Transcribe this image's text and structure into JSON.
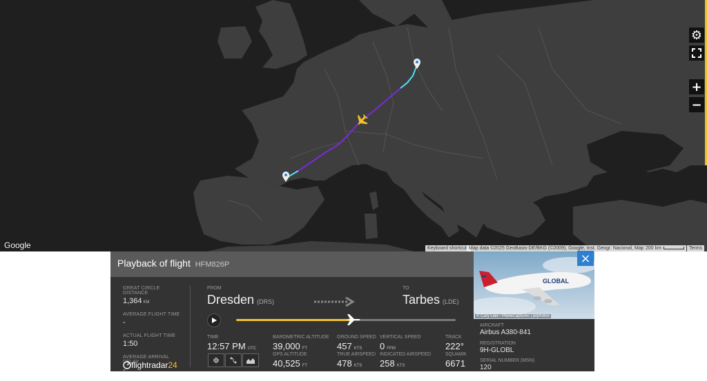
{
  "map": {
    "google_label": "Google",
    "attribution": {
      "shortcuts": "Keyboard shortcuts",
      "data": "Map data ©2025 GeoBasis-DE/BKG (©2009), Google, Inst. Geogr. Nacional, Mapa GISrael",
      "scale": "200 km",
      "terms": "Terms"
    },
    "controls": {
      "settings_icon": "gear-icon",
      "fullscreen_icon": "fullscreen-icon",
      "zoom_in": "+",
      "zoom_out": "−"
    },
    "colors": {
      "water": "#1f1f1f",
      "land": "#3e3e3e",
      "route_start": "#4fe0ff",
      "route_main": "#7a2bd6",
      "aircraft": "#f2c12e"
    }
  },
  "playback": {
    "title": "Playback of flight",
    "callsign": "HFM826P",
    "stats": [
      {
        "label": "GREAT CIRCLE DISTANCE",
        "value": "1,364",
        "unit": "KM"
      },
      {
        "label": "AVERAGE FLIGHT TIME",
        "value": "-",
        "unit": ""
      },
      {
        "label": "ACTUAL FLIGHT TIME",
        "value": "1:50",
        "unit": ""
      },
      {
        "label": "AVERAGE ARRIVAL DELAY",
        "value": "-",
        "unit": ""
      }
    ],
    "logo": {
      "text": "flightradar",
      "num": "24"
    },
    "from_label": "FROM",
    "from_city": "Dresden",
    "from_code": "(DRS)",
    "to_label": "TO",
    "to_city": "Tarbes",
    "to_code": "(LDE)",
    "progress": 0.53,
    "metrics": {
      "time": {
        "label": "TIME",
        "value": "12:57 PM",
        "unit": "UTC"
      },
      "baro_alt": {
        "label": "BAROMETRIC ALTITUDE",
        "value": "39,000",
        "unit": "FT"
      },
      "gps_alt": {
        "label": "GPS ALTITUDE",
        "value": "40,525",
        "unit": "FT"
      },
      "ground_speed": {
        "label": "GROUND SPEED",
        "value": "457",
        "unit": "KTS"
      },
      "true_airspeed": {
        "label": "TRUE AIRSPEED",
        "value": "478",
        "unit": "KTS"
      },
      "vertical_speed": {
        "label": "VERTICAL SPEED",
        "value": "0",
        "unit": "FPM"
      },
      "indicated_airspeed": {
        "label": "INDICATED AIRSPEED",
        "value": "258",
        "unit": "KTS"
      },
      "track": {
        "label": "TRACK",
        "value": "222°",
        "unit": ""
      },
      "squawk": {
        "label": "SQUAWK",
        "value": "6671",
        "unit": ""
      }
    }
  },
  "aircraft_panel": {
    "photo_credit": "© Cary Liao - PlaneCaptures | jetphotos",
    "livery_text": "GLOBAL",
    "close_icon": "×",
    "aircraft_label": "AIRCRAFT",
    "aircraft_value": "Airbus A380-841",
    "registration_label": "REGISTRATION",
    "registration_value": "9H-GLOBL",
    "serial_label": "SERIAL NUMBER (MSN)",
    "serial_value": "120"
  }
}
